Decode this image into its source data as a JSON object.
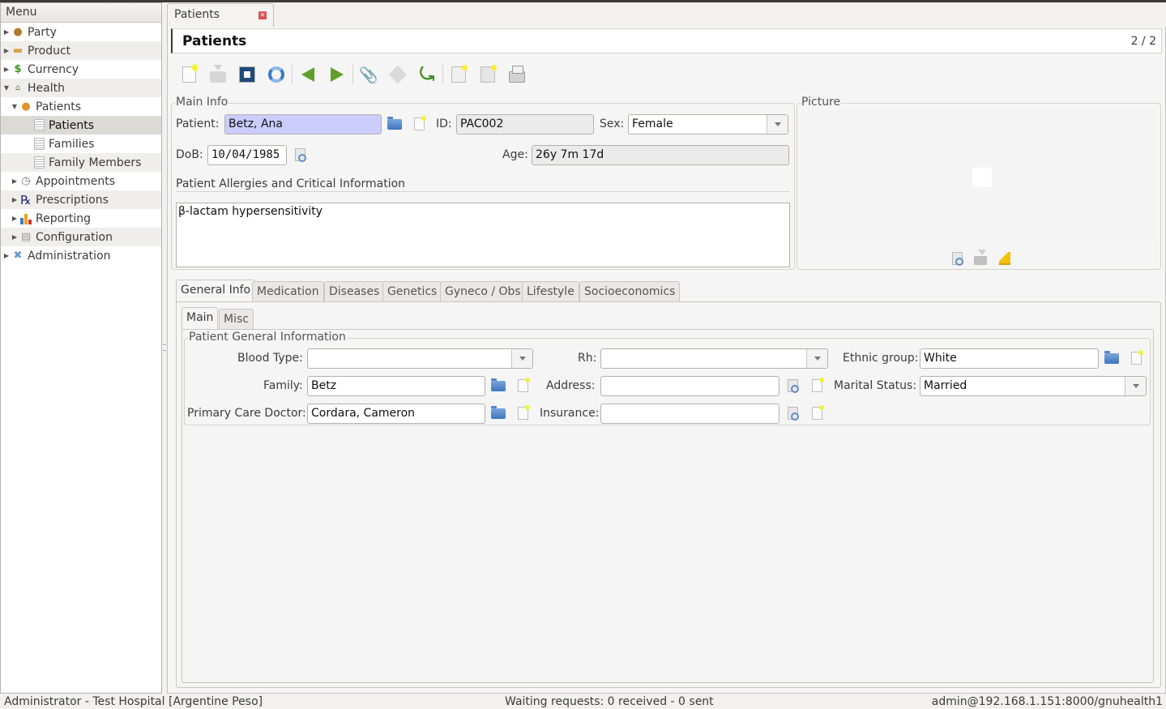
{
  "menu": {
    "header": "Menu",
    "items": [
      {
        "label": "Party",
        "icon": "party-icon",
        "level": 0,
        "expanded": false
      },
      {
        "label": "Product",
        "icon": "product-icon",
        "level": 0,
        "expanded": false
      },
      {
        "label": "Currency",
        "icon": "currency-icon",
        "level": 0,
        "expanded": false
      },
      {
        "label": "Health",
        "icon": "health-icon",
        "level": 0,
        "expanded": true
      },
      {
        "label": "Patients",
        "icon": "patient-icon",
        "level": 1,
        "expanded": true
      },
      {
        "label": "Patients",
        "icon": "document-icon",
        "level": 2,
        "selected": true
      },
      {
        "label": "Families",
        "icon": "document-icon",
        "level": 2
      },
      {
        "label": "Family Members",
        "icon": "document-icon",
        "level": 2
      },
      {
        "label": "Appointments",
        "icon": "clock-icon",
        "level": 1,
        "expanded": false
      },
      {
        "label": "Prescriptions",
        "icon": "rx-icon",
        "level": 1,
        "expanded": false
      },
      {
        "label": "Reporting",
        "icon": "bar-chart-icon",
        "level": 1,
        "expanded": false
      },
      {
        "label": "Configuration",
        "icon": "configuration-icon",
        "level": 1,
        "expanded": false
      },
      {
        "label": "Administration",
        "icon": "tools-icon",
        "level": 0,
        "expanded": false
      }
    ]
  },
  "tab": {
    "label": "Patients"
  },
  "header": {
    "title": "Patients",
    "record_counter": "2 / 2"
  },
  "toolbar": {
    "buttons": [
      "new",
      "save",
      "switch-view",
      "reload",
      "previous",
      "next",
      "attachment",
      "action",
      "relate",
      "report",
      "email-report",
      "print"
    ]
  },
  "main_info": {
    "group_label": "Main Info",
    "patient_label": "Patient:",
    "patient_value": "Betz, Ana",
    "id_label": "ID:",
    "id_value": "PAC002",
    "sex_label": "Sex:",
    "sex_value": "Female",
    "dob_label": "DoB:",
    "dob_value": "10/04/1985",
    "age_label": "Age:",
    "age_value": "26y 7m 17d",
    "allergies_label": "Patient Allergies and Critical Information",
    "allergies_value": "β-lactam hypersensitivity"
  },
  "picture": {
    "group_label": "Picture"
  },
  "tabs": [
    "General Info",
    "Medication",
    "Diseases",
    "Genetics",
    "Gyneco / Obs",
    "Lifestyle",
    "Socioeconomics"
  ],
  "subtabs": [
    "Main",
    "Misc"
  ],
  "general": {
    "group_label": "Patient General Information",
    "blood_type_label": "Blood Type:",
    "blood_type_value": "",
    "rh_label": "Rh:",
    "rh_value": "",
    "ethnic_label": "Ethnic group:",
    "ethnic_value": "White",
    "family_label": "Family:",
    "family_value": "Betz",
    "address_label": "Address:",
    "address_value": "",
    "marital_label": "Marital Status:",
    "marital_value": "Married",
    "doctor_label": "Primary Care Doctor:",
    "doctor_value": "Cordara, Cameron",
    "insurance_label": "Insurance:",
    "insurance_value": ""
  },
  "status": {
    "user": "Administrator - Test Hospital [Argentine Peso]",
    "requests": "Waiting requests: 0 received - 0 sent",
    "connection": "admin@192.168.1.151:8000/gnuhealth1"
  },
  "colors": {
    "required_field": "#ccccff",
    "readonly_field": "#ebebeb",
    "accent_green": "#5fa02a"
  }
}
